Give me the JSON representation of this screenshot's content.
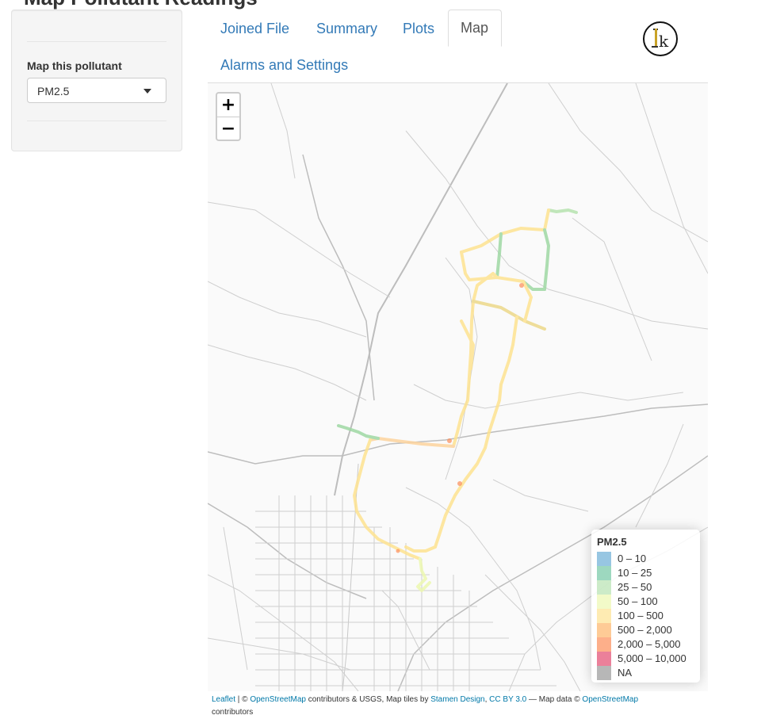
{
  "page": {
    "title_cut": "Map Pollutant Readings"
  },
  "sidebar": {
    "label": "Map this pollutant",
    "select_value": "PM2.5"
  },
  "tabs": [
    {
      "label": "Joined File",
      "active": false
    },
    {
      "label": "Summary",
      "active": false
    },
    {
      "label": "Plots",
      "active": false
    },
    {
      "label": "Map",
      "active": true
    },
    {
      "label": "Alarms and Settings",
      "active": false
    }
  ],
  "logo": {
    "letters": "Ik"
  },
  "map": {
    "zoom_in": "+",
    "zoom_out": "−",
    "legend": {
      "title": "PM2.5",
      "entries": [
        {
          "label": "0 – 10",
          "color": "#6baed6"
        },
        {
          "label": "10 – 25",
          "color": "#74c7a4"
        },
        {
          "label": "25 – 50",
          "color": "#b7e3b0"
        },
        {
          "label": "50 – 100",
          "color": "#edf8b1"
        },
        {
          "label": "100 – 500",
          "color": "#fee391"
        },
        {
          "label": "500 – 2,000",
          "color": "#fdb56a"
        },
        {
          "label": "2,000 – 5,000",
          "color": "#fc8d59"
        },
        {
          "label": "5,000 – 10,000",
          "color": "#e34a6f"
        },
        {
          "label": "NA",
          "color": "#999999"
        }
      ]
    },
    "attribution": {
      "leaflet": "Leaflet",
      "sep1": " | © ",
      "osm1": "OpenStreetMap",
      "text1": " contributors & USGS, Map tiles by ",
      "stamen": "Stamen Design",
      "comma": ", ",
      "ccby": "CC BY 3.0",
      "text2": " — Map data © ",
      "osm2": "OpenStreetMap",
      "text3": "contributors"
    }
  }
}
